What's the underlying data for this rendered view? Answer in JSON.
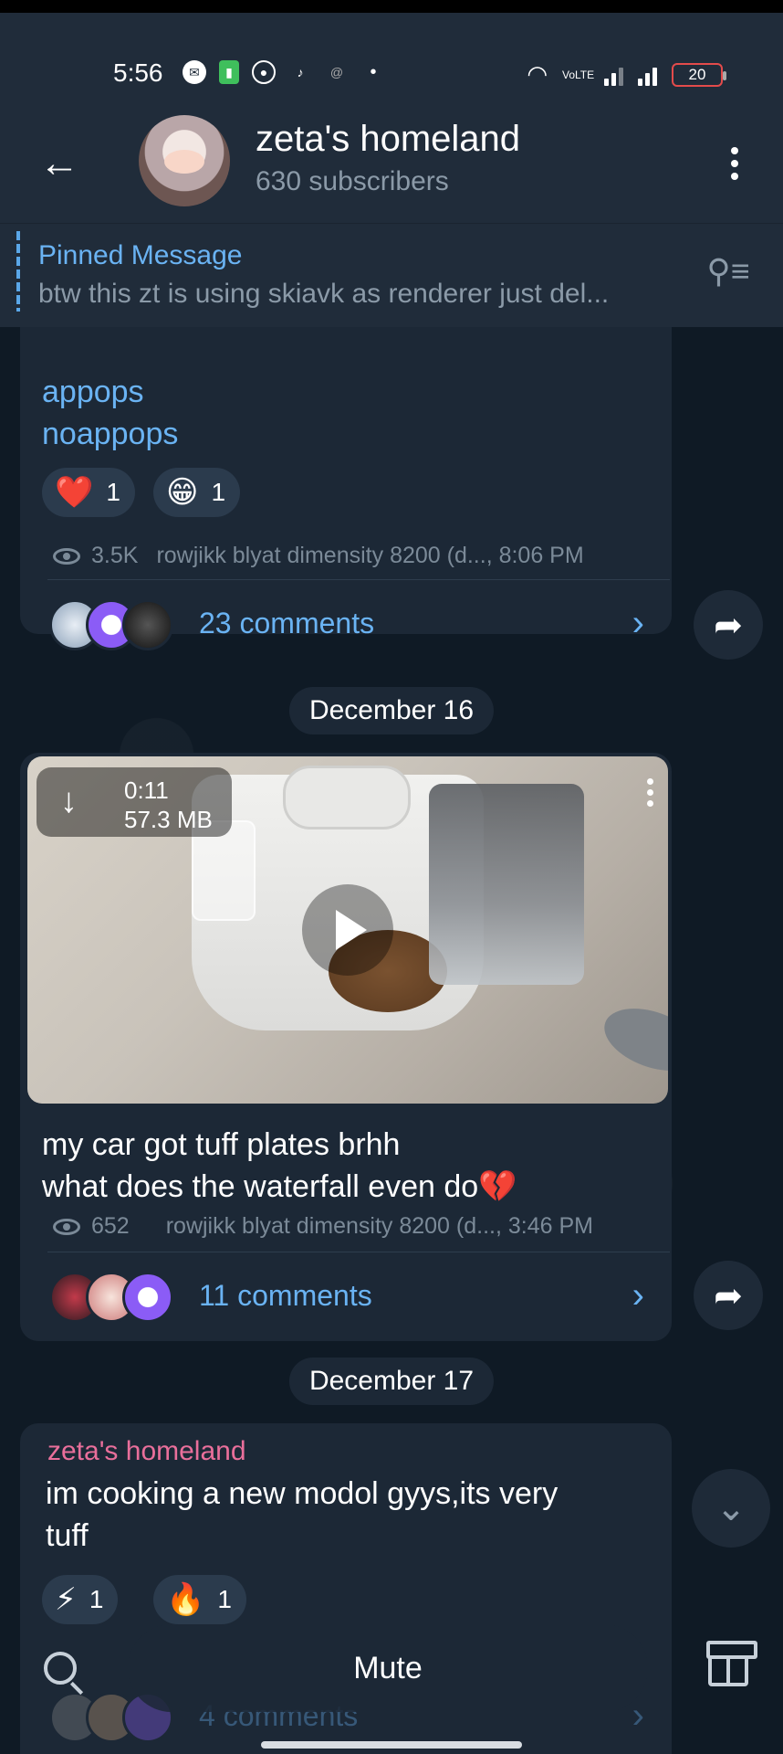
{
  "status_bar": {
    "time": "5:56",
    "battery": "20",
    "network_label": "VoLTE"
  },
  "header": {
    "title": "zeta's homeland",
    "subtitle": "630 subscribers"
  },
  "pinned": {
    "title": "Pinned Message",
    "text": "btw this zt is using skiavk as renderer  just del..."
  },
  "messages": [
    {
      "lines": [
        "appops",
        "noappops"
      ],
      "reactions": [
        {
          "emoji": "❤️",
          "count": "1"
        },
        {
          "emoji": "😁",
          "count": "1"
        }
      ],
      "views": "3.5K",
      "meta": "rowjikk blyat dimensity 8200 (d..., 8:06 PM",
      "comments": "23 comments"
    },
    {
      "date": "December 16",
      "video": {
        "duration": "0:11",
        "size": "57.3 MB"
      },
      "lines": [
        "my car got tuff plates brhh",
        "what does the waterfall even do💔"
      ],
      "views": "652",
      "meta": "rowjikk blyat dimensity 8200 (d..., 3:46 PM",
      "comments": "11 comments"
    },
    {
      "date": "December 17",
      "author": "zeta's homeland",
      "lines": [
        "im cooking a new modol gyys,its very",
        "tuff"
      ],
      "reactions": [
        {
          "emoji": "⚡",
          "count": "1"
        },
        {
          "emoji": "🔥",
          "count": "1"
        }
      ],
      "comments": "4 comments"
    }
  ],
  "bottom_bar": {
    "mute_label": "Mute"
  },
  "colors": {
    "header_bg": "#202c3a",
    "chat_bg": "#0f1a25",
    "bubble_bg": "#1c2836",
    "accent": "#6ab3f3",
    "author": "#e96f9b"
  }
}
